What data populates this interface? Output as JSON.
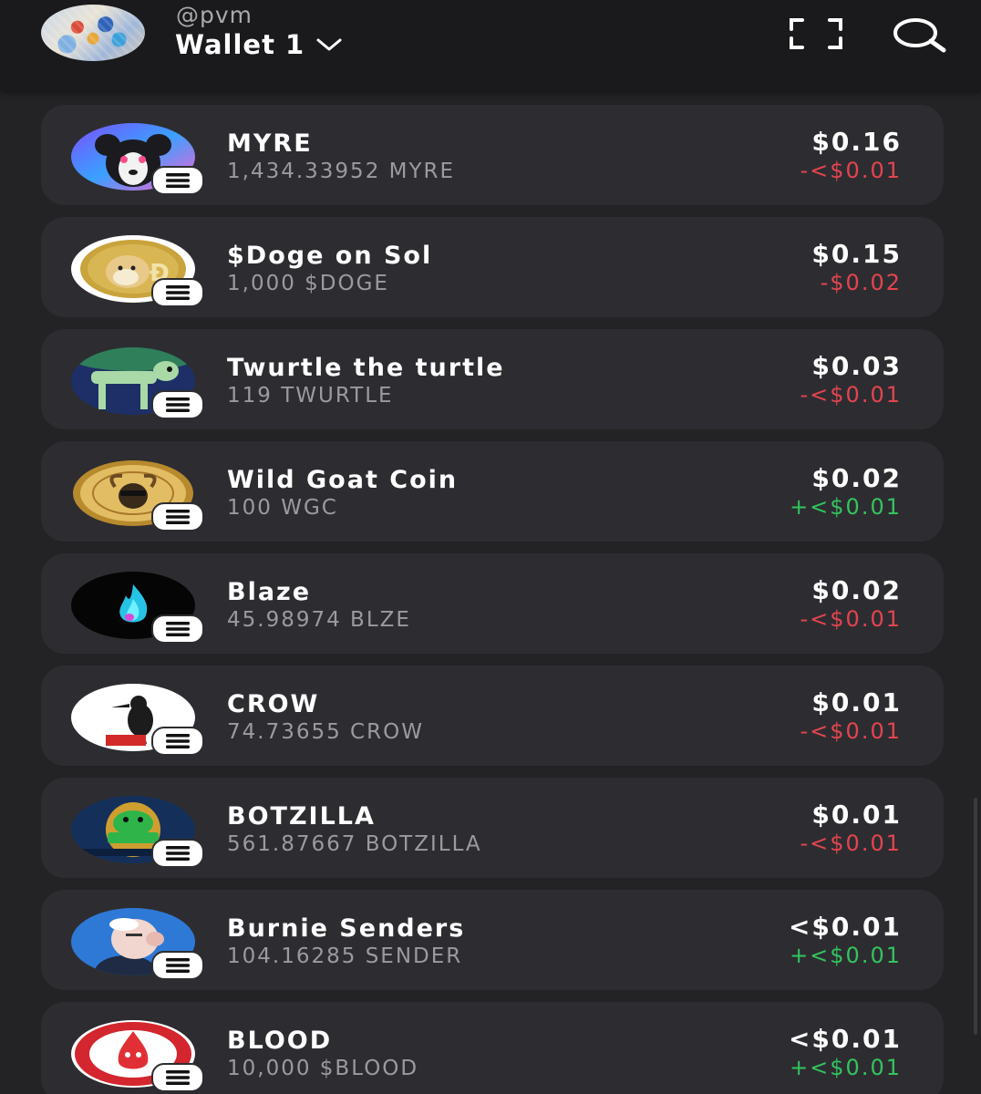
{
  "header": {
    "handle": "@pvm",
    "wallet_name": "Wallet 1",
    "icons": {
      "avatar": "profile-avatar",
      "wallet_chevron": "chevron-down-icon",
      "scan": "scan-qr-icon",
      "search": "search-icon"
    }
  },
  "tokens": [
    {
      "name": "MYRE",
      "amount": "1,434.33952 MYRE",
      "value": "$0.16",
      "change": "-<$0.01",
      "direction": "down",
      "logo": "dog-logo"
    },
    {
      "name": "$Doge on Sol",
      "amount": "1,000 $DOGE",
      "value": "$0.15",
      "change": "-$0.02",
      "direction": "down",
      "logo": "doge-coin-logo"
    },
    {
      "name": "Twurtle the turtle",
      "amount": "119 TWURTLE",
      "value": "$0.03",
      "change": "-<$0.01",
      "direction": "down",
      "logo": "turtle-logo"
    },
    {
      "name": "Wild Goat Coin",
      "amount": "100 WGC",
      "value": "$0.02",
      "change": "+<$0.01",
      "direction": "up",
      "logo": "goat-coin-logo"
    },
    {
      "name": "Blaze",
      "amount": "45.98974 BLZE",
      "value": "$0.02",
      "change": "-<$0.01",
      "direction": "down",
      "logo": "flame-logo"
    },
    {
      "name": "CROW",
      "amount": "74.73655 CROW",
      "value": "$0.01",
      "change": "-<$0.01",
      "direction": "down",
      "logo": "crow-logo"
    },
    {
      "name": "BOTZILLA",
      "amount": "561.87667 BOTZILLA",
      "value": "$0.01",
      "change": "-<$0.01",
      "direction": "down",
      "logo": "botzilla-logo"
    },
    {
      "name": "Burnie Senders",
      "amount": "104.16285 SENDER",
      "value": "<$0.01",
      "change": "+<$0.01",
      "direction": "up",
      "logo": "senders-logo"
    },
    {
      "name": "BLOOD",
      "amount": "10,000 $BLOOD",
      "value": "<$0.01",
      "change": "+<$0.01",
      "direction": "up",
      "logo": "blood-drop-logo"
    }
  ],
  "colors": {
    "background": "#232325",
    "header_bg": "#1a1a1c",
    "card_bg": "#2d2d31",
    "negative": "#e4444f",
    "positive": "#33c45f",
    "muted_text": "#9a9aa0"
  },
  "chain_badge_icon": "solana-icon"
}
